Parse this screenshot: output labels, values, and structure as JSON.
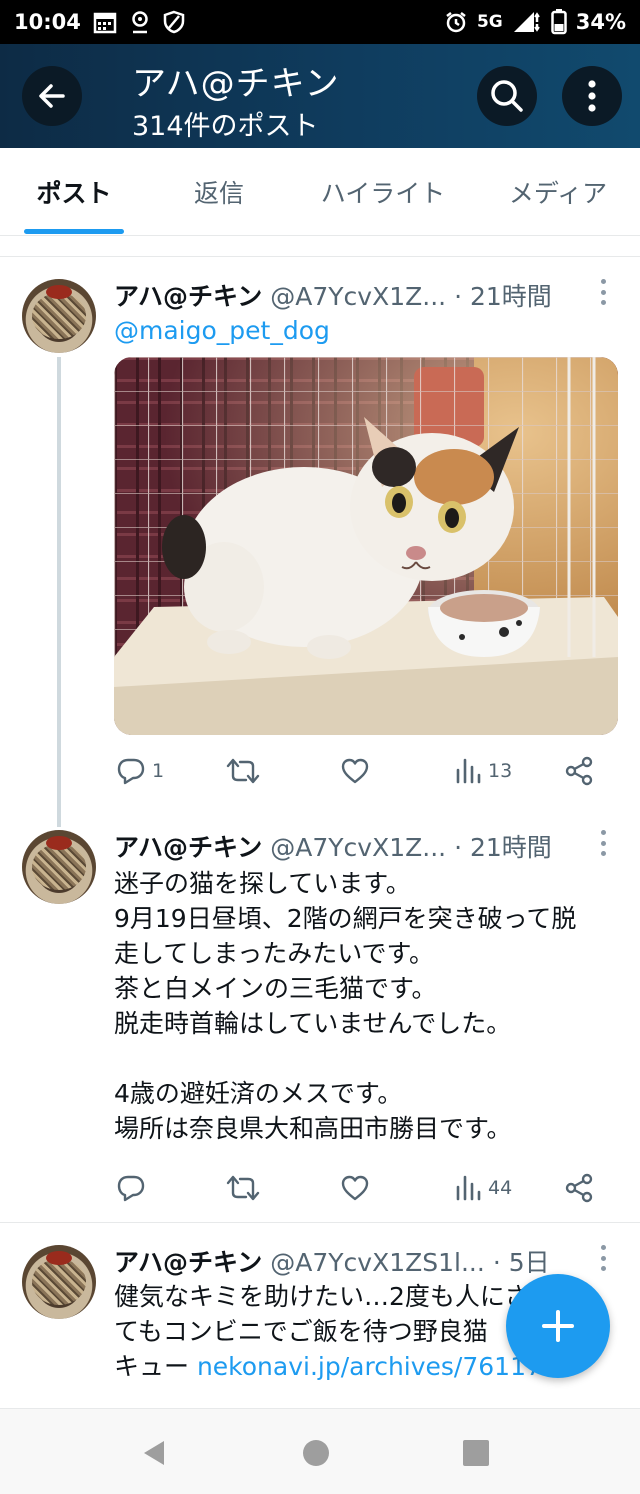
{
  "status_bar": {
    "time": "10:04",
    "network": "5G",
    "battery": "34%",
    "icons": [
      "calendar-icon",
      "location-icon",
      "shield-icon",
      "alarm-icon",
      "signal-icon",
      "battery-icon"
    ]
  },
  "header": {
    "title": "アハ@チキン",
    "subtitle": "314件のポスト",
    "back_icon": "arrow-left-icon",
    "search_icon": "search-icon",
    "more_icon": "more-vertical-icon"
  },
  "tabs": [
    {
      "label": "ポスト",
      "active": true
    },
    {
      "label": "返信",
      "active": false
    },
    {
      "label": "ハイライト",
      "active": false
    },
    {
      "label": "メディア",
      "active": false
    }
  ],
  "posts": [
    {
      "name": "アハ@チキン",
      "handle": "@A7YcvX1Z...",
      "time": "· 21時間",
      "mention": "@maigo_pet_dog",
      "has_media": true,
      "actions": {
        "replies": "1",
        "retweets": "",
        "likes": "",
        "views": "13"
      }
    },
    {
      "name": "アハ@チキン",
      "handle": "@A7YcvX1Z...",
      "time": "· 21時間",
      "text_lines": [
        "迷子の猫を探しています。",
        "9月19日昼頃、2階の網戸を突き破って脱",
        "走してしまったみたいです。",
        "茶と白メインの三毛猫です。",
        "脱走時首輪はしていませんでした。",
        "",
        "4歳の避妊済のメスです。",
        "場所は奈良県大和高田市勝目です。"
      ],
      "actions": {
        "replies": "",
        "retweets": "",
        "likes": "",
        "views": "44"
      }
    },
    {
      "name": "アハ@チキン",
      "handle": "@A7YcvX1ZS1l...",
      "time": "· 5日",
      "text_lines": [
        "健気なキミを助けたい…2度も人にされ",
        "てもコンビニでご飯を待つ野良猫",
        "キュー "
      ],
      "link": "nekonavi.jp/archives/76117"
    }
  ],
  "fab": {
    "icon": "plus-icon"
  },
  "nav_bar": {
    "icons": [
      "back-triangle-icon",
      "home-circle-icon",
      "recents-square-icon"
    ]
  },
  "colors": {
    "accent": "#1d9bf0",
    "header_bg": "#0f3c5e",
    "text_secondary": "#536471"
  }
}
